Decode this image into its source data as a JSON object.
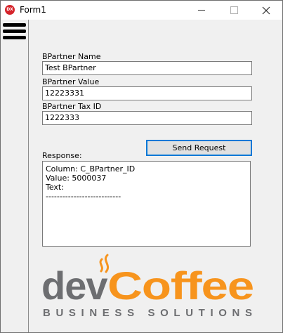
{
  "window": {
    "title": "Form1",
    "icon_text": "DX"
  },
  "form": {
    "name_label": "BPartner Name",
    "name_value": "Test BPartner",
    "value_label": "BPartner Value",
    "value_value": "12223331",
    "taxid_label": "BPartner Tax ID",
    "taxid_value": "1222333",
    "send_button": "Send Request",
    "response_label": "Response:",
    "response_lines": [
      "Column: C_BPartner_ID",
      "Value: 5000037",
      "Text:",
      "---------------------------"
    ]
  },
  "logo": {
    "word_dev": "dev",
    "word_coffee": "Coffee",
    "tagline": "BUSINESS SOLUTIONS",
    "colors": {
      "dev": "#6d6e71",
      "coffee": "#f7941d",
      "tagline": "#6d6e71",
      "steam": "#f7941d"
    }
  },
  "colors": {
    "accent": "#0078d7",
    "icon_red": "#d5242b"
  }
}
